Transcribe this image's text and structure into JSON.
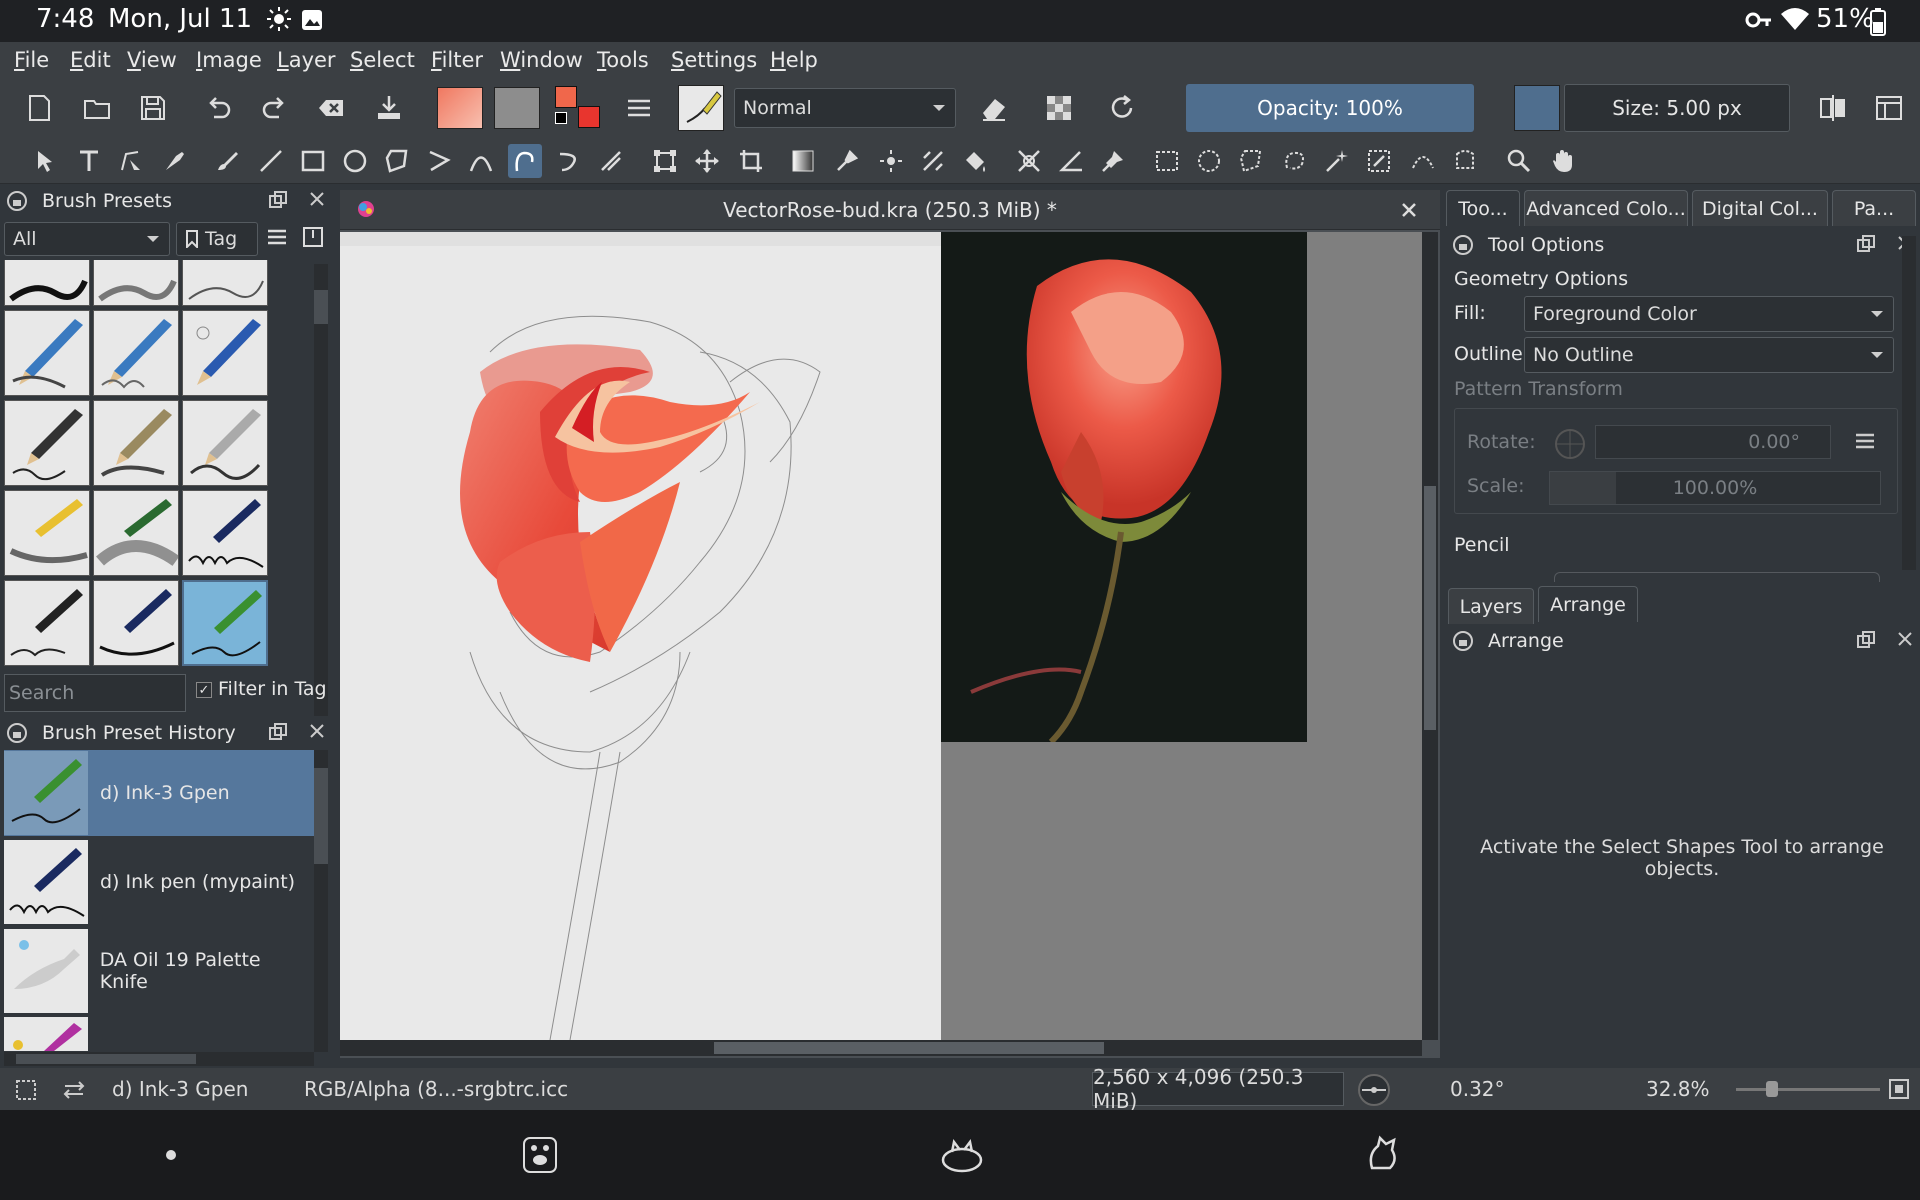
{
  "system_status": {
    "time": "7:48",
    "date": "Mon, Jul 11",
    "battery": "51%"
  },
  "menu": [
    "File",
    "Edit",
    "View",
    "Image",
    "Layer",
    "Select",
    "Filter",
    "Window",
    "Tools",
    "Settings",
    "Help"
  ],
  "toolbar": {
    "blend_mode": "Normal",
    "opacity": "Opacity: 100%",
    "size": "Size: 5.00 px"
  },
  "brush_presets": {
    "title": "Brush Presets",
    "filter_value": "All",
    "tag_label": "Tag",
    "search_placeholder": "Search",
    "filter_in_tag": "Filter in Tag"
  },
  "brush_history": {
    "title": "Brush Preset History",
    "items": [
      "d) Ink-3 Gpen",
      "d) Ink pen (mypaint)",
      "DA Oil 19 Palette Knife"
    ]
  },
  "document": {
    "title": "VectorRose-bud.kra (250.3 MiB)  *"
  },
  "right_tabs": [
    "Too...",
    "Advanced Colo...",
    "Digital Col...",
    "Pa..."
  ],
  "tool_options": {
    "title": "Tool Options",
    "section": "Geometry Options",
    "fill_label": "Fill:",
    "fill_value": "Foreground Color",
    "outline_label": "Outline:",
    "outline_value": "No Outline",
    "pattern_transform": "Pattern Transform",
    "rotate_label": "Rotate:",
    "rotate_value": "0.00°",
    "scale_label": "Scale:",
    "scale_value": "100.00%",
    "pencil_label": "Pencil"
  },
  "lower_tabs": [
    "Layers",
    "Arrange"
  ],
  "arrange": {
    "title": "Arrange",
    "message": "Activate the Select Shapes Tool to arrange objects."
  },
  "bottom_status": {
    "brush": "d) Ink-3 Gpen",
    "color_profile": "RGB/Alpha (8...-srgbtrc.icc",
    "dimensions": "2,560 x 4,096 (250.3 MiB)",
    "rotation": "0.32°",
    "zoom": "32.8%"
  },
  "colors": {
    "accent": "#4f6e8e",
    "selected_row": "#55779c",
    "foreground_color": "#f0674b"
  }
}
